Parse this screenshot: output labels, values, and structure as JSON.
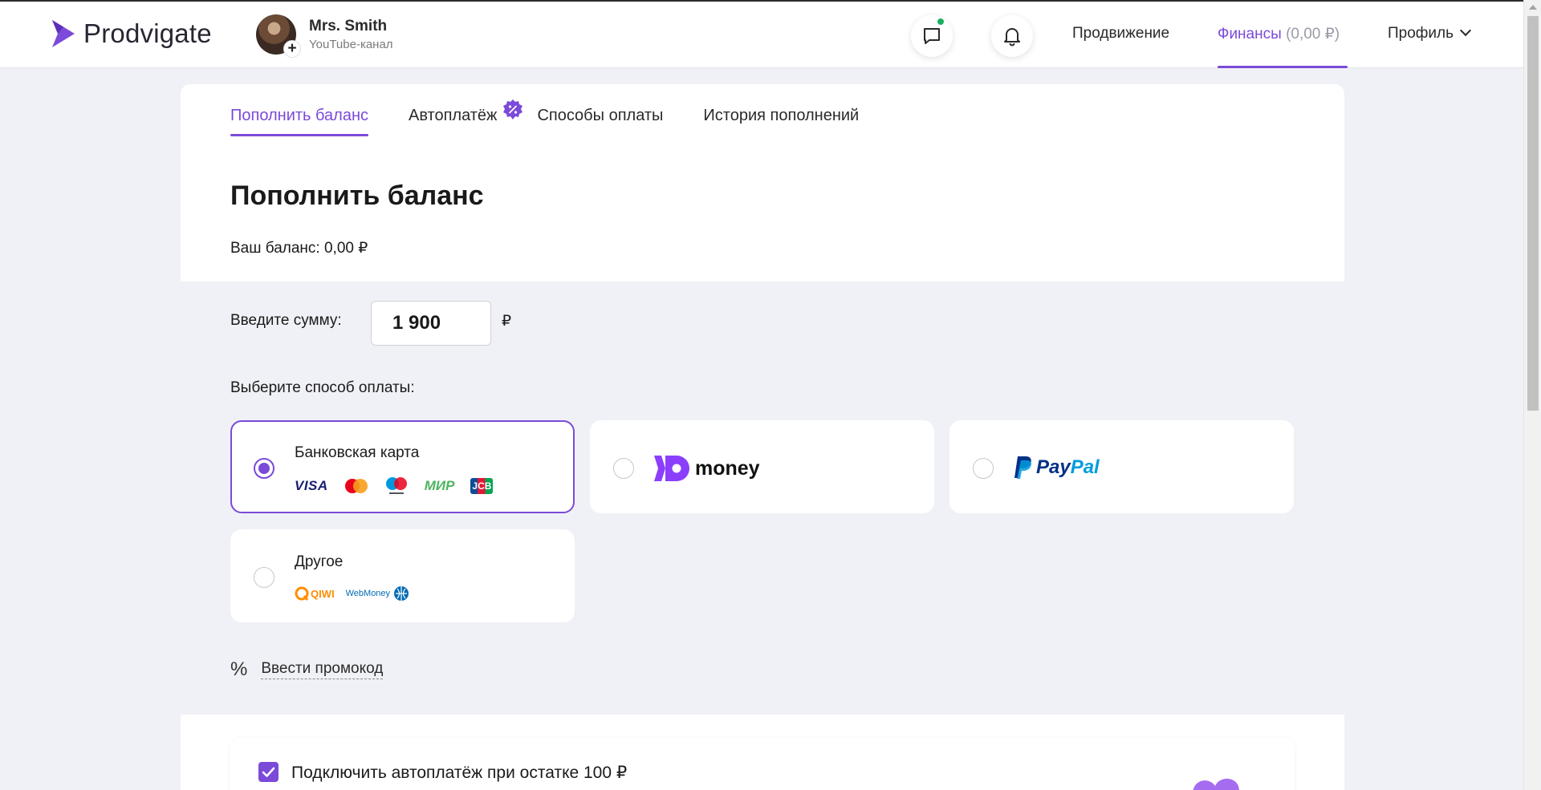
{
  "app": {
    "logo_text": "Prodvigate"
  },
  "account": {
    "name": "Mrs. Smith",
    "subtitle": "YouTube-канал",
    "add_symbol": "+"
  },
  "header": {
    "chat_icon": "chat-icon",
    "bell_icon": "bell-icon",
    "nav": {
      "promotion": "Продвижение",
      "finance": "Финансы",
      "finance_amount": "(0,00 ₽)",
      "profile": "Профиль"
    },
    "accent_color": "#7b4ad9",
    "status_dot_color": "#1ab061"
  },
  "tabs": [
    {
      "label": "Пополнить баланс",
      "active": true
    },
    {
      "label": "Автоплатёж",
      "active": false,
      "badge_icon": "percent-badge-icon"
    },
    {
      "label": "Способы оплаты",
      "active": false
    },
    {
      "label": "История пополнений",
      "active": false
    }
  ],
  "page": {
    "title": "Пополнить баланс",
    "balance": "Ваш баланс: 0,00 ₽"
  },
  "form": {
    "sum_label": "Введите сумму:",
    "sum_value": "1 900",
    "currency": "₽",
    "method_label": "Выберите способ оплаты:"
  },
  "payment_methods": [
    {
      "id": "card",
      "title": "Банковская карта",
      "selected": true,
      "icons": [
        "VISA",
        "mastercard-icon",
        "maestro-icon",
        "МИР",
        "JCB"
      ]
    },
    {
      "id": "yoomoney",
      "logo_text": "money",
      "selected": false
    },
    {
      "id": "paypal",
      "logo_text_1": "Pay",
      "logo_text_2": "Pal",
      "selected": false
    },
    {
      "id": "other",
      "title": "Другое",
      "selected": false,
      "icons": [
        "QIWI",
        "WebMoney"
      ]
    }
  ],
  "promo": {
    "symbol": "%",
    "link": "Ввести промокод"
  },
  "autopay": {
    "checked": true,
    "text": "Подключить автоплатёж при остатке 100 ₽"
  }
}
